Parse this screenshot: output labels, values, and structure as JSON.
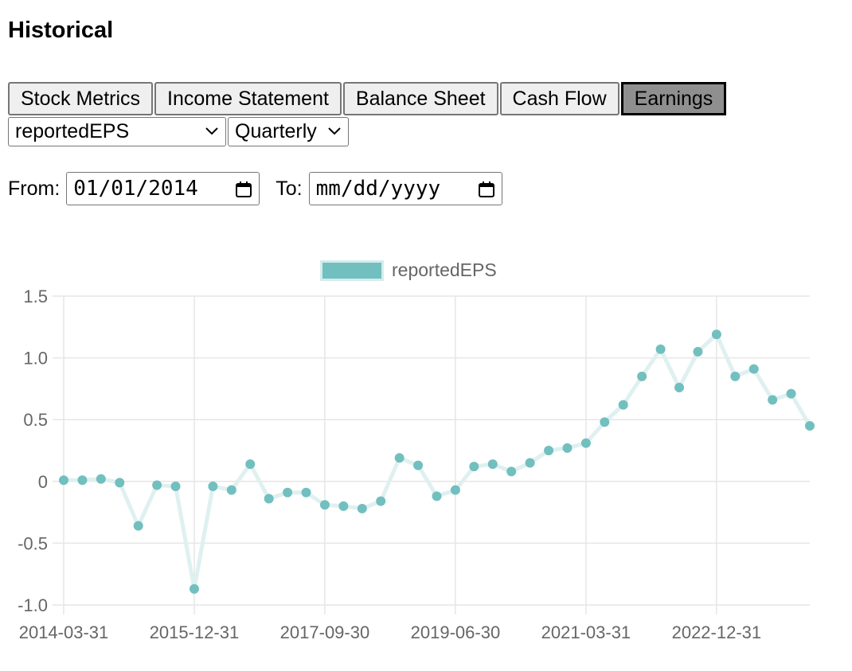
{
  "page": {
    "title": "Historical"
  },
  "tabs": [
    {
      "label": "Stock Metrics",
      "active": false
    },
    {
      "label": "Income Statement",
      "active": false
    },
    {
      "label": "Balance Sheet",
      "active": false
    },
    {
      "label": "Cash Flow",
      "active": false
    },
    {
      "label": "Earnings",
      "active": true
    }
  ],
  "selects": {
    "metric": "reportedEPS",
    "period": "Quarterly"
  },
  "dates": {
    "from_label": "From:",
    "from_value": "01/01/2014",
    "to_label": "To:",
    "to_placeholder": "mm/dd/yyyy"
  },
  "colors": {
    "series": "#72bfbf",
    "series_line": "#dff0f0",
    "grid": "#e6e6e6",
    "tick": "#666666"
  },
  "chart_data": {
    "type": "line",
    "legend": {
      "label": "reportedEPS",
      "position": "top"
    },
    "ylim": [
      -1.0,
      1.5
    ],
    "yticks": [
      "1.5",
      "1.0",
      "0.5",
      "0",
      "-0.5",
      "-1.0"
    ],
    "xtick_labels": [
      "2014-03-31",
      "2015-12-31",
      "2017-09-30",
      "2019-06-30",
      "2021-03-31",
      "2022-12-31"
    ],
    "grid": true,
    "series": [
      {
        "name": "reportedEPS",
        "x": [
          "2014-03-31",
          "2014-06-30",
          "2014-09-30",
          "2014-12-31",
          "2015-03-31",
          "2015-06-30",
          "2015-09-30",
          "2015-12-31",
          "2016-03-31",
          "2016-06-30",
          "2016-09-30",
          "2016-12-31",
          "2017-03-31",
          "2017-06-30",
          "2017-09-30",
          "2017-12-31",
          "2018-03-31",
          "2018-06-30",
          "2018-09-30",
          "2018-12-31",
          "2019-03-31",
          "2019-06-30",
          "2019-09-30",
          "2019-12-31",
          "2020-03-31",
          "2020-06-30",
          "2020-09-30",
          "2020-12-31",
          "2021-03-31",
          "2021-06-30",
          "2021-09-30",
          "2021-12-31",
          "2022-03-31",
          "2022-06-30",
          "2022-09-30",
          "2022-12-31",
          "2023-03-31",
          "2023-06-30",
          "2023-09-30",
          "2023-12-31",
          "2024-03-31"
        ],
        "values": [
          0.01,
          0.01,
          0.02,
          -0.01,
          -0.36,
          -0.03,
          -0.04,
          -0.87,
          -0.04,
          -0.07,
          0.14,
          -0.14,
          -0.09,
          -0.09,
          -0.19,
          -0.2,
          -0.22,
          -0.16,
          0.19,
          0.13,
          -0.12,
          -0.07,
          0.12,
          0.14,
          0.08,
          0.15,
          0.25,
          0.27,
          0.31,
          0.48,
          0.62,
          0.85,
          1.07,
          0.76,
          1.05,
          1.19,
          0.85,
          0.91,
          0.66,
          0.71,
          0.45
        ]
      }
    ]
  }
}
